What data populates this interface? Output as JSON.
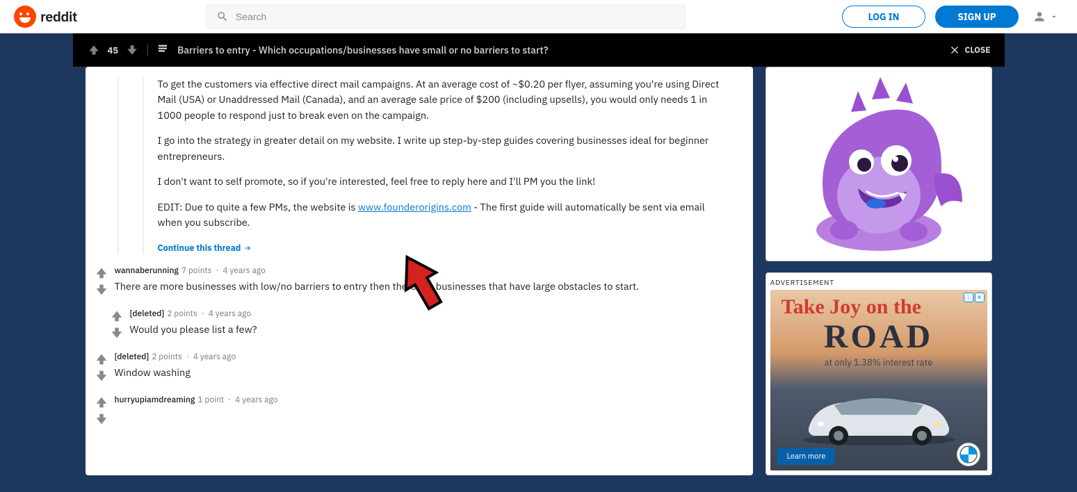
{
  "header": {
    "brand": "reddit",
    "search_placeholder": "Search",
    "login": "LOG IN",
    "signup": "SIGN UP"
  },
  "overlay": {
    "score": "45",
    "title": "Barriers to entry - Which occupations/businesses have small or no barriers to start?",
    "close": "CLOSE"
  },
  "thread": {
    "nested": {
      "p1": "To get the customers via effective direct mail campaigns. At an average cost of ~$0.20 per flyer, assuming you're using Direct Mail (USA) or Unaddressed Mail (Canada), and an average sale price of $200 (including upsells), you would only needs 1 in 1000 people to respond just to break even on the campaign.",
      "p2": "I go into the strategy in greater detail on my website. I write up step-by-step guides covering businesses ideal for beginner entrepreneurs.",
      "p3": "I don't want to self promote, so if you're interested, feel free to reply here and I'll PM you the link!",
      "p4a": "EDIT: Due to quite a few PMs, the website is ",
      "p4link": "www.founderorigins.com",
      "p4b": " - The first guide will automatically be sent via email when you subscribe.",
      "continue": "Continue this thread"
    },
    "comments": [
      {
        "author": "wannaberunning",
        "points": "7 points",
        "age": "4 years ago",
        "body": "There are more businesses with low/no barriers to entry then there are businesses that have large obstacles to start."
      },
      {
        "author": "[deleted]",
        "points": "2 points",
        "age": "4 years ago",
        "body": "Would you please list a few?",
        "indent": true
      },
      {
        "author": "[deleted]",
        "points": "2 points",
        "age": "4 years ago",
        "body": "Window washing"
      },
      {
        "author": "hurryupiamdreaming",
        "points": "1 point",
        "age": "4 years ago",
        "body": ""
      }
    ]
  },
  "sidebar": {
    "ad": {
      "label": "ADVERTISEMENT",
      "script": "Take Joy on the",
      "road": "ROAD",
      "rate": "at only 1.38% interest rate",
      "cta": "Learn more",
      "brand": "BMW"
    }
  }
}
